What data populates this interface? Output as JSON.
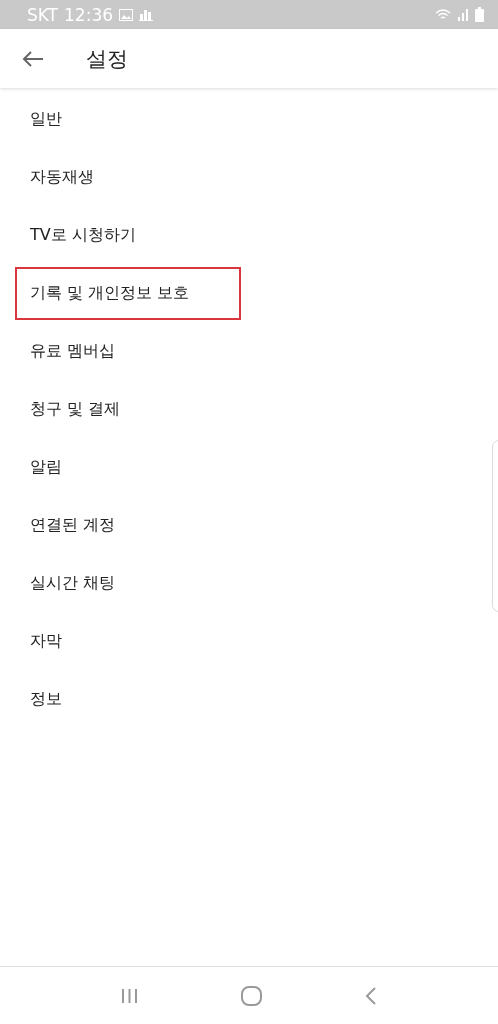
{
  "status_bar": {
    "carrier": "SKT",
    "time": "12:36"
  },
  "header": {
    "title": "설정"
  },
  "settings_items": [
    {
      "label": "일반",
      "highlighted": false
    },
    {
      "label": "자동재생",
      "highlighted": false
    },
    {
      "label": "TV로 시청하기",
      "highlighted": false
    },
    {
      "label": "기록 및 개인정보 보호",
      "highlighted": true
    },
    {
      "label": "유료 멤버십",
      "highlighted": false
    },
    {
      "label": "청구 및 결제",
      "highlighted": false
    },
    {
      "label": "알림",
      "highlighted": false
    },
    {
      "label": "연결된 계정",
      "highlighted": false
    },
    {
      "label": "실시간 채팅",
      "highlighted": false
    },
    {
      "label": "자막",
      "highlighted": false
    },
    {
      "label": "정보",
      "highlighted": false
    }
  ]
}
